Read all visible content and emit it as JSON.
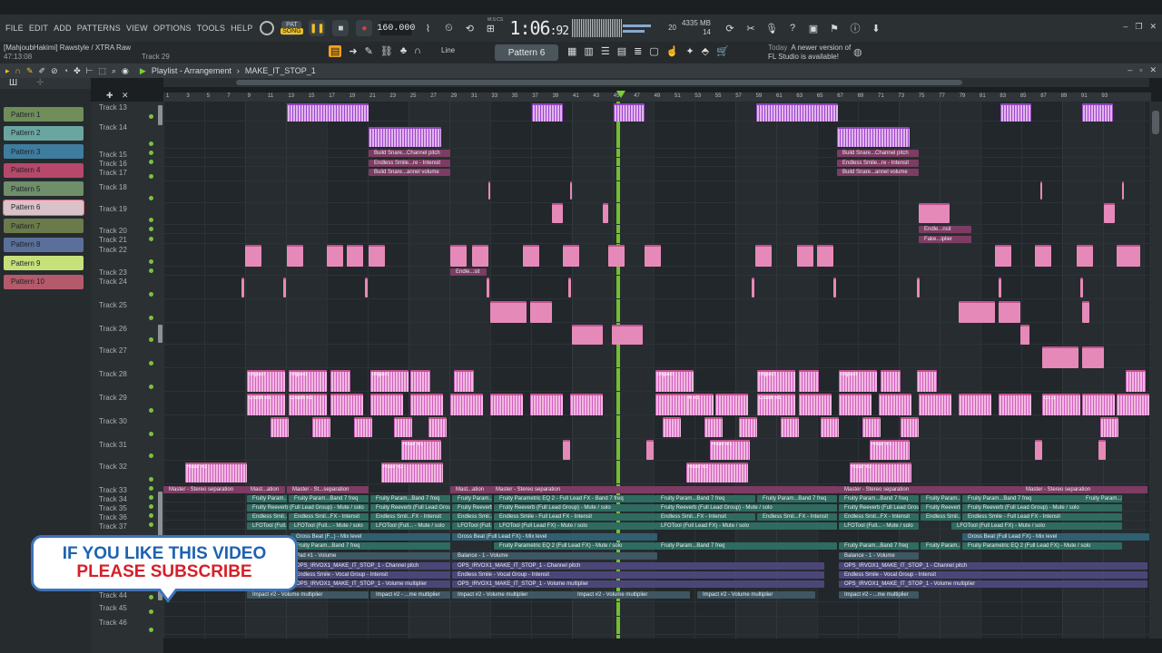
{
  "menu": [
    "FILE",
    "EDIT",
    "ADD",
    "PATTERNS",
    "VIEW",
    "OPTIONS",
    "TOOLS",
    "HELP"
  ],
  "transport": {
    "pat_label": "PAT",
    "song_label": "SONG",
    "tempo": "160.000",
    "time_main": "1:06",
    "time_frac": ":92",
    "time_unit": "M:S:CS",
    "cpu_value": "20",
    "memory": "4335 MB",
    "polyphony": "14"
  },
  "project": {
    "author_title": "[MahjoubHakimi] Rawstyle / XTRA Raw",
    "elapsed": "47:13:08",
    "hint_track": "Track 29"
  },
  "snap_label": "Line",
  "pattern_selector": "Pattern 6",
  "news": {
    "when": "Today",
    "text1": "A newer version of",
    "text2": "FL Studio is available!"
  },
  "playlist": {
    "title": "Playlist - Arrangement",
    "sep": "›",
    "song": "MAKE_IT_STOP_1"
  },
  "patterns": [
    {
      "label": "Pattern 1",
      "color": "#6f8e5a"
    },
    {
      "label": "Pattern 2",
      "color": "#6aa6a0"
    },
    {
      "label": "Pattern 3",
      "color": "#3f7d9e"
    },
    {
      "label": "Pattern 4",
      "color": "#b5486b"
    },
    {
      "label": "Pattern 5",
      "color": "#6f8e6a"
    },
    {
      "label": "Pattern 6",
      "color": "#d9c3c8"
    },
    {
      "label": "Pattern 7",
      "color": "#6b7a4a"
    },
    {
      "label": "Pattern 8",
      "color": "#5a6f9a"
    },
    {
      "label": "Pattern 9",
      "color": "#c6e07a"
    },
    {
      "label": "Pattern 10",
      "color": "#b55a6a"
    }
  ],
  "ruler": [
    "1",
    "3",
    "5",
    "7",
    "9",
    "11",
    "13",
    "15",
    "17",
    "19",
    "21",
    "23",
    "25",
    "27",
    "29",
    "31",
    "33",
    "35",
    "37",
    "39",
    "41",
    "43",
    "45",
    "47",
    "49",
    "51",
    "53",
    "55",
    "57",
    "59",
    "61",
    "63",
    "65",
    "67",
    "69",
    "71",
    "73",
    "75",
    "77",
    "79",
    "81",
    "83",
    "85",
    "87",
    "89",
    "91",
    "93"
  ],
  "tracks": [
    "Track 13",
    "Track 14",
    "Track 15",
    "Track 16",
    "Track 17",
    "Track 18",
    "Track 19",
    "Track 20",
    "Track 21",
    "Track 22",
    "Track 23",
    "Track 24",
    "Track 25",
    "Track 26",
    "Track 27",
    "Track 28",
    "Track 29",
    "Track 30",
    "Track 31",
    "Track 32",
    "Track 33",
    "Track 34",
    "Track 35",
    "Track 36",
    "Track 37",
    "Track 44",
    "Track 45",
    "Track 46"
  ],
  "clip_labels": {
    "impact": "Impact",
    "crash": "Crash #1",
    "riser1": "Riser #1",
    "riser2": "Riser #2",
    "build_pitch": "Build Snare...Channel pitch",
    "endless_int": "Endless Smile...re - Intensit",
    "build_vol": "Build Snare...annel volume",
    "endle_nsit": "Endle...nsit",
    "fake_iplier": "Fake...iplier",
    "endle_sit": "Endle...sit",
    "cr1": "Cr..1"
  },
  "automation": {
    "master_stereo": "Master - Stereo separation",
    "master_short": "Mast...ation",
    "master_st": "Master - St...separation",
    "fruity_band7": "Fruity Param...Band 7 freq",
    "fruity_eq": "Fruity Parametric EQ 2 - Full Lead FX - Band 7 freq",
    "fruity_solo": "Fruity Reeverb (Full Lead Group) - Mute / solo",
    "reeverb": "Fruity Reeverb (Full Lead Group) - Mute / solo",
    "endless_fx": "Endless Smil...FX - Intensit",
    "endless_lead": "Endless Smile - Full Lead FX - Intensit",
    "lfo": "LFOTool (Full Lead FX) - Mute / solo",
    "lfo_short": "LFOTool (Full... - Mute / solo",
    "gross": "Gross Beat (F...) - Mix level",
    "gross_full": "Gross Beat (Full Lead FX) - Mix level",
    "fruity_eq2": "Fruity Parametric EQ 2 (Full Lead FX) - Mute / solo",
    "volume": "Pad #1 - Volume",
    "balance": "Balance - 1 - Volume",
    "channel_pitch": "OPS_IRVOX1_MAKE_IT_STOP_1 - Channel pitch",
    "vocal": "Endless Smile - Vocal Group - Intensit",
    "vol_mult": "OPS_IRVOX1_MAKE_IT_STOP_1 - Volume multiplier",
    "impact_vol": "Impact #2 - Volume multiplier",
    "impact_me": "Impact #2 - ...me multiplier"
  },
  "subscribe": {
    "line1": "IF YOU LIKE THIS VIDEO",
    "line2": "PLEASE SUBSCRIBE"
  }
}
